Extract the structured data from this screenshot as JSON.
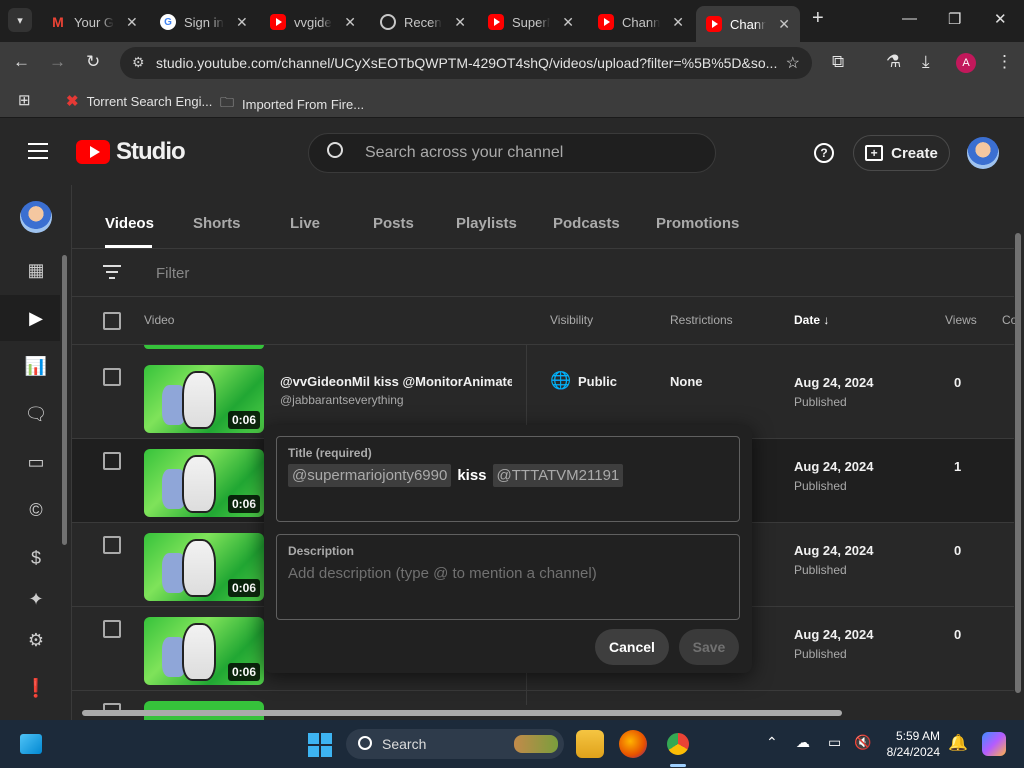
{
  "browser": {
    "tabs": [
      {
        "title": "Your Gmail",
        "icon": "gmail-icon"
      },
      {
        "title": "Sign in",
        "icon": "google-icon"
      },
      {
        "title": "vvgideon",
        "icon": "youtube-icon"
      },
      {
        "title": "Recent",
        "icon": "globe-icon"
      },
      {
        "title": "SuperM",
        "icon": "youtube-icon"
      },
      {
        "title": "Channel",
        "icon": "youtube-icon"
      },
      {
        "title": "Channel",
        "icon": "youtube-icon",
        "active": true
      }
    ],
    "url": "studio.youtube.com/channel/UCyXsEOTbQWPTM-429OT4shQ/videos/upload?filter=%5B%5D&so...",
    "profile_initial": "A",
    "bookmarks": [
      {
        "label": "Torrent Search Engi..."
      },
      {
        "label": "Imported From Fire..."
      }
    ]
  },
  "studio": {
    "logo_text": "Studio",
    "search_placeholder": "Search across your channel",
    "create_label": "Create",
    "video_tabs": [
      "Videos",
      "Shorts",
      "Live",
      "Posts",
      "Playlists",
      "Podcasts",
      "Promotions"
    ],
    "active_tab": "Videos",
    "filter_placeholder": "Filter",
    "columns": {
      "video": "Video",
      "visibility": "Visibility",
      "restrictions": "Restrictions",
      "date": "Date",
      "views": "Views",
      "comments": "Co"
    },
    "rows": [
      {
        "title": "@vvGideonMil kiss @MonitorAnimate...",
        "channel": "@jabbarantseverything",
        "duration": "0:06",
        "visibility": "Public",
        "restrictions": "None",
        "date": "Aug 24, 2024",
        "status": "Published",
        "views": "0"
      },
      {
        "duration": "0:06",
        "date": "Aug 24, 2024",
        "status": "Published",
        "views": "1"
      },
      {
        "duration": "0:06",
        "date": "Aug 24, 2024",
        "status": "Published",
        "views": "0"
      },
      {
        "duration": "0:06",
        "date": "Aug 24, 2024",
        "status": "Published",
        "views": "0"
      }
    ]
  },
  "edit_dialog": {
    "title_label": "Title (required)",
    "title_mention_1": "@supermariojonty6990",
    "title_word": "kiss",
    "title_mention_2": "@TTTATVM21191",
    "description_label": "Description",
    "description_placeholder": "Add description (type @ to mention a channel)",
    "cancel_label": "Cancel",
    "save_label": "Save"
  },
  "taskbar": {
    "search_label": "Search",
    "time": "5:59 AM",
    "date": "8/24/2024"
  },
  "colors": {
    "youtube_red": "#ff0000",
    "background": "#282828",
    "modal": "#212121"
  }
}
